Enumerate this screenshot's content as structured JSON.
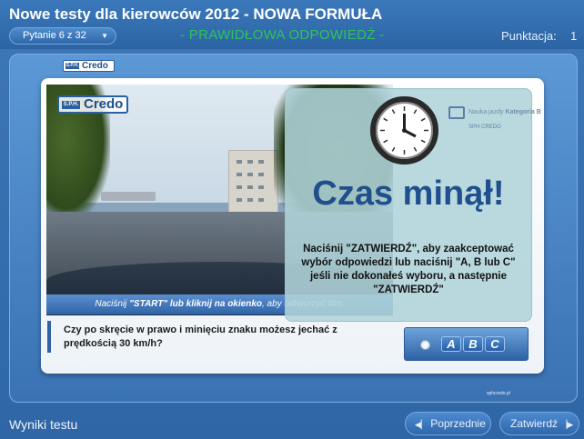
{
  "header": {
    "title": "Nowe testy dla kierowców 2012 - NOWA FORMUŁA",
    "question_selector": "Pytanie 6 z 32",
    "status": "- PRAWIDŁOWA ODPOWIEDŹ -",
    "score_label": "Punktacja:",
    "score_value": "1"
  },
  "logo": {
    "small_text": "Credo",
    "small_prefix": "S.P.H.",
    "video_text": "Credo",
    "video_prefix": "S.P.H."
  },
  "video": {
    "caption_start": "Naciśnij ",
    "caption_bold": "\"START\" lub kliknij na okienko",
    "caption_end": ", aby odtworzyć film."
  },
  "overlay": {
    "brand_text": "Nauka jazdy",
    "brand_kat": "Kategoria B",
    "brand_sub": "SPH CREDO",
    "message": "Czas minął!",
    "instruction": "Naciśnij \"ZATWIERDŹ\", aby zaakceptować wybór odpowiedzi lub naciśnij \"A, B lub C\" jeśli nie dokonałeś wyboru, a następnie \"ZATWIERDŹ\""
  },
  "question": {
    "text": "Czy po skręcie w prawo i minięciu znaku możesz jechać z prędkością 30 km/h?"
  },
  "answers": {
    "a": "A",
    "b": "B",
    "c": "C"
  },
  "footer": {
    "brand": "sphcredo.pl",
    "results": "Wyniki testu",
    "prev": "Poprzednie",
    "next": "Zatwierdź"
  },
  "icons": {
    "prev": "prev-arrow-icon",
    "next": "next-arrow-icon",
    "dropdown": "chevron-down-icon",
    "clock": "clock-icon"
  }
}
